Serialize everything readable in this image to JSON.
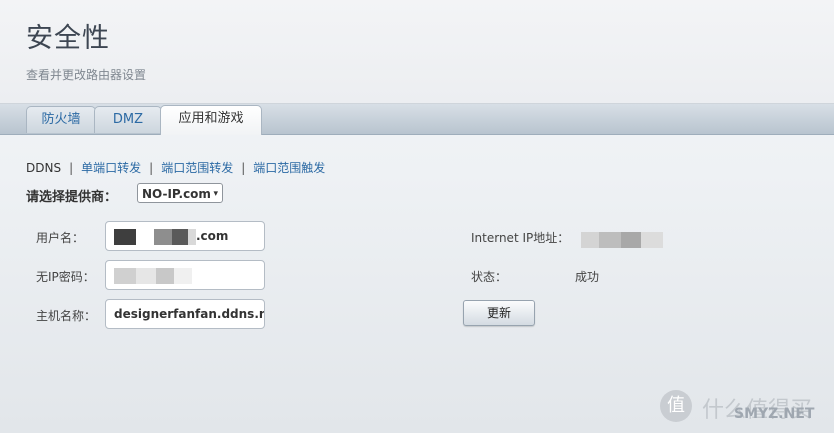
{
  "header": {
    "title": "安全性",
    "subtitle": "查看并更改路由器设置"
  },
  "tabs": [
    {
      "label": "防火墙",
      "active": false
    },
    {
      "label": "DMZ",
      "active": false
    },
    {
      "label": "应用和游戏",
      "active": true
    }
  ],
  "subnav": {
    "items": [
      {
        "label": "DDNS",
        "current": true
      },
      {
        "label": "单端口转发",
        "current": false
      },
      {
        "label": "端口范围转发",
        "current": false
      },
      {
        "label": "端口范围触发",
        "current": false
      }
    ],
    "separator": "|"
  },
  "provider": {
    "label": "请选择提供商：",
    "selected": "NO-IP.com"
  },
  "form": {
    "username_label": "用户名：",
    "username_value_suffix": ".com",
    "password_label": "无IP密码：",
    "hostname_label": "主机名称：",
    "hostname_value": "designerfanfan.ddns.ne"
  },
  "status": {
    "ip_label": "Internet IP地址：",
    "state_label": "状态：",
    "state_value": "成功",
    "update_button": "更新"
  },
  "watermark": {
    "text": "什么值得买",
    "site": "SMYZ.NET",
    "logo": "值"
  },
  "colors": {
    "link": "#2c6aa4",
    "title": "#3d4652",
    "tabbar": "#c4ced8"
  },
  "icons": {
    "select_chevron": "chevron-down-icon"
  }
}
